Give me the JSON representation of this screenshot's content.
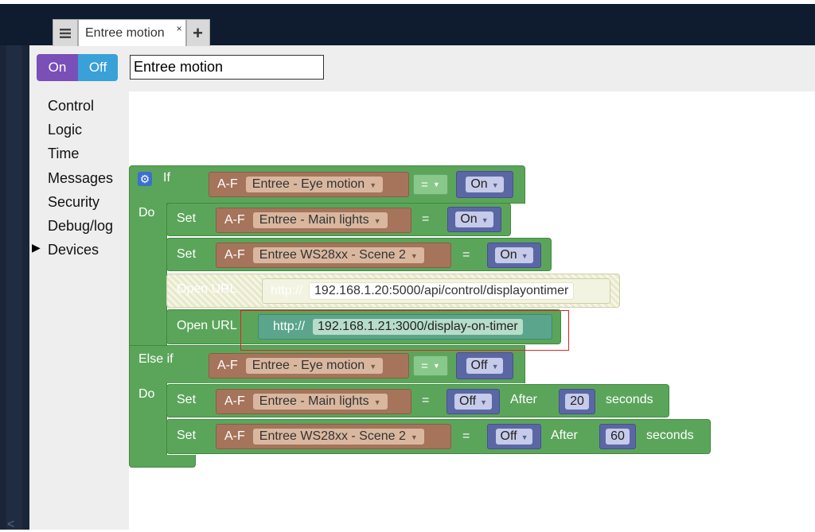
{
  "tab": {
    "title": "Entree motion",
    "close": "×",
    "add": "+"
  },
  "toggle": {
    "on": "On",
    "off": "Off"
  },
  "rule_name": "Entree motion",
  "categories": [
    "Control",
    "Logic",
    "Time",
    "Messages",
    "Security",
    "Debug/log",
    "Devices"
  ],
  "blocks": {
    "if_label": "If",
    "do_label": "Do",
    "else_if_label": "Else if",
    "set_label": "Set",
    "af": "A-F",
    "eq": "=",
    "open_url_label": "Open URL",
    "http": "http://",
    "after": "After",
    "seconds": "seconds",
    "if_device": "Entree - Eye motion",
    "if_value": "On",
    "set1_device": "Entree - Main lights",
    "set1_value": "On",
    "set2_device": "Entree WS28xx - Scene 2",
    "set2_value": "On",
    "url_disabled": "192.168.1.20:5000/api/control/displayontimer",
    "url_active": "192.168.1.21:3000/display-on-timer",
    "elseif_device": "Entree - Eye motion",
    "elseif_value": "Off",
    "set3_device": "Entree - Main lights",
    "set3_value": "Off",
    "set3_after": "20",
    "set4_device": "Entree WS28xx - Scene 2",
    "set4_value": "Off",
    "set4_after": "60"
  },
  "icons": {
    "tab_menu": "hamburger-icon",
    "gear": "gear-icon",
    "collapse": "chevron-left-icon",
    "devices": "triangle-right-icon"
  }
}
